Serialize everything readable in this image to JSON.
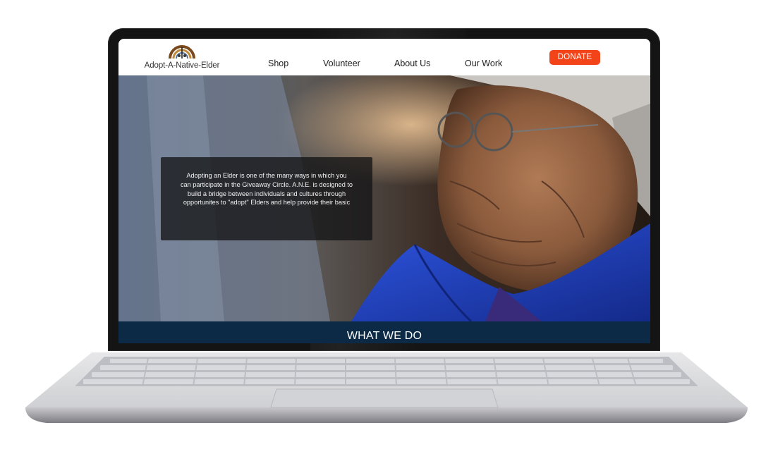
{
  "site": {
    "logo_text": "Adopt-A-Native-Elder",
    "nav": [
      {
        "label": "Shop"
      },
      {
        "label": "Volunteer"
      },
      {
        "label": "About Us"
      },
      {
        "label": "Our Work"
      }
    ],
    "donate_label": "DONATE"
  },
  "hero": {
    "text": "Adopting an Elder is one of the many ways in which you\ncan participate in the Giveaway Circle. A.N.E. is designed to\nbuild a bridge between individuals and cultures through\nopportunites to \"adopt\" Elders and help provide their basic"
  },
  "section": {
    "title": "WHAT WE DO"
  },
  "colors": {
    "donate": "#f24418",
    "band": "#0c2a45",
    "coat": "#1e3fc2"
  },
  "icons": [
    "logo-emblem-icon"
  ]
}
